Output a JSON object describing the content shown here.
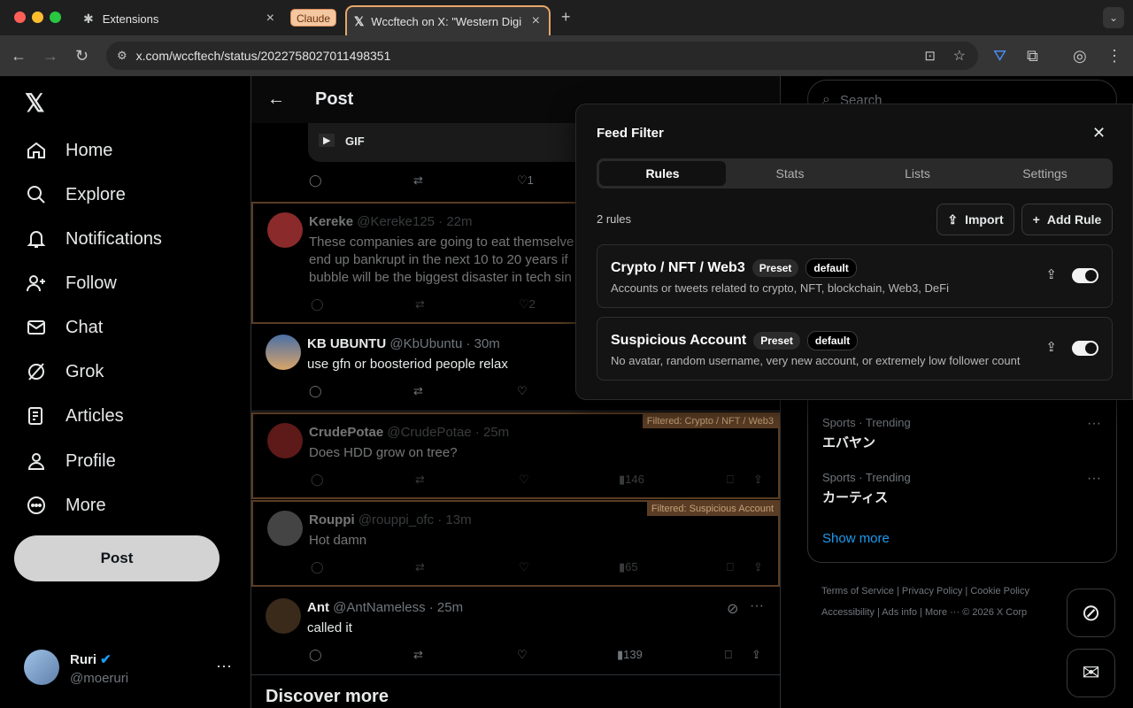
{
  "browser": {
    "tabs": [
      {
        "label": "Extensions"
      },
      {
        "label": "Wccftech on X: \"Western Digi"
      }
    ],
    "group_label": "Claude",
    "url": "x.com/wccftech/status/2022758027011498351"
  },
  "nav": {
    "items": [
      {
        "label": "Home",
        "icon": "home-icon"
      },
      {
        "label": "Explore",
        "icon": "search-icon"
      },
      {
        "label": "Notifications",
        "icon": "bell-icon"
      },
      {
        "label": "Follow",
        "icon": "follow-icon"
      },
      {
        "label": "Chat",
        "icon": "mail-icon"
      },
      {
        "label": "Grok",
        "icon": "grok-icon"
      },
      {
        "label": "Articles",
        "icon": "articles-icon"
      },
      {
        "label": "Profile",
        "icon": "profile-icon"
      },
      {
        "label": "More",
        "icon": "more-circle-icon"
      }
    ],
    "post_button": "Post",
    "user": {
      "name": "Ruri",
      "handle": "@moeruri"
    }
  },
  "main": {
    "title": "Post",
    "gif_label": "GIF",
    "top_likes": "1",
    "tweets": [
      {
        "name": "Kereke",
        "handle": "@Kereke125 · 22m",
        "lines": [
          "These companies are going to eat themselve",
          "end up bankrupt in the next 10 to 20 years if",
          "bubble will be the biggest disaster in tech sin"
        ],
        "likes": "2"
      },
      {
        "name": "KB UBUNTU",
        "handle": "@KbUbuntu · 30m",
        "lines": [
          "use gfn or boosteriod people relax"
        ]
      },
      {
        "name": "CrudePotae",
        "handle": "@CrudePotae · 25m",
        "lines": [
          "Does HDD grow on tree?"
        ],
        "views": "146",
        "badge": "Filtered: Crypto / NFT / Web3"
      },
      {
        "name": "Rouppi",
        "handle": "@rouppi_ofc · 13m",
        "lines": [
          "Hot damn"
        ],
        "views": "65",
        "badge": "Filtered: Suspicious Account"
      },
      {
        "name": "Ant",
        "handle": "@AntNameless · 25m",
        "lines": [
          "called it"
        ],
        "views": "139"
      }
    ],
    "discover": "Discover more"
  },
  "right": {
    "search_placeholder": "Search",
    "trends": [
      {
        "context": "Sports · Trending",
        "name": "エバヤン"
      },
      {
        "context": "Sports · Trending",
        "name": "カーティス"
      }
    ],
    "show_more": "Show more",
    "footer": [
      "Terms of Service",
      "Privacy Policy",
      "Cookie Policy",
      "Accessibility",
      "Ads info",
      "More ···",
      "© 2026 X Corp"
    ]
  },
  "feed_filter": {
    "title": "Feed Filter",
    "tabs": [
      "Rules",
      "Stats",
      "Lists",
      "Settings"
    ],
    "count": "2 rules",
    "import_label": "Import",
    "add_label": "Add Rule",
    "rules": [
      {
        "title": "Crypto / NFT / Web3",
        "tag1": "Preset",
        "tag2": "default",
        "desc": "Accounts or tweets related to crypto, NFT, blockchain, Web3, DeFi",
        "enabled": true
      },
      {
        "title": "Suspicious Account",
        "tag1": "Preset",
        "tag2": "default",
        "desc": "No avatar, random username, very new account, or extremely low follower count",
        "enabled": true
      }
    ]
  },
  "colors": {
    "accent": "#1d9bf0",
    "filtered_border": "#5a3d24",
    "tab_outline": "#e8a56a"
  }
}
